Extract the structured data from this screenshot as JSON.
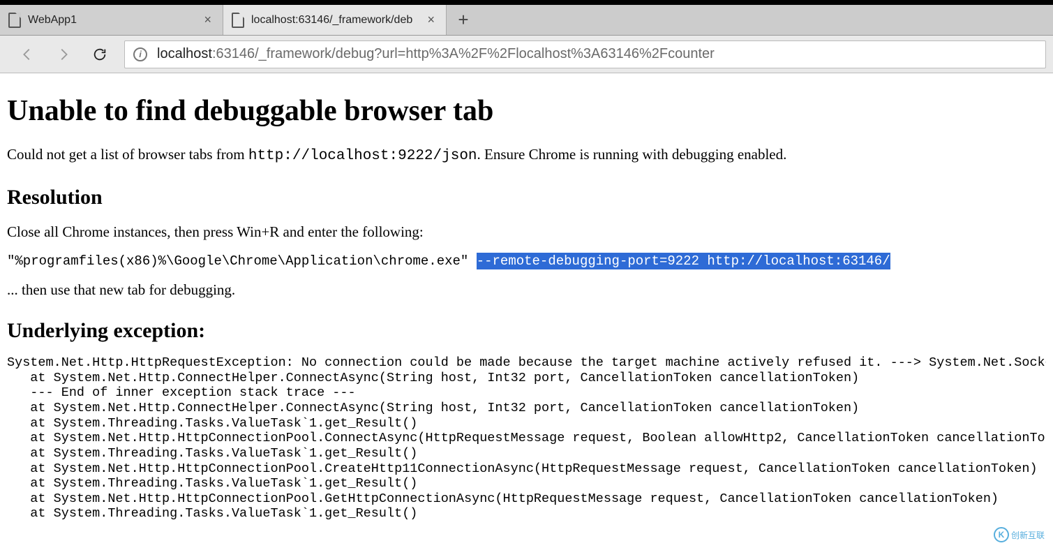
{
  "browser": {
    "tabs": [
      {
        "title": "WebApp1",
        "active": false
      },
      {
        "title": "localhost:63146/_framework/deb",
        "active": true
      }
    ],
    "new_tab_label": "+",
    "url_host": "localhost",
    "url_rest": ":63146/_framework/debug?url=http%3A%2F%2Flocalhost%3A63146%2Fcounter"
  },
  "page": {
    "heading": "Unable to find debuggable browser tab",
    "para1_prefix": "Could not get a list of browser tabs from ",
    "para1_code": "http://localhost:9222/json",
    "para1_suffix": ". Ensure Chrome is running with debugging enabled.",
    "resolution_heading": "Resolution",
    "resolution_intro": "Close all Chrome instances, then press Win+R and enter the following:",
    "cmd_unselected": "\"%programfiles(x86)%\\Google\\Chrome\\Application\\chrome.exe\" ",
    "cmd_selected": "--remote-debugging-port=9222 http://localhost:63146/",
    "resolution_outro": "... then use that new tab for debugging.",
    "exception_heading": "Underlying exception:",
    "stack_lines": [
      "System.Net.Http.HttpRequestException: No connection could be made because the target machine actively refused it. ---> System.Net.Sockets.SocketExcep",
      "   at System.Net.Http.ConnectHelper.ConnectAsync(String host, Int32 port, CancellationToken cancellationToken)",
      "   --- End of inner exception stack trace ---",
      "   at System.Net.Http.ConnectHelper.ConnectAsync(String host, Int32 port, CancellationToken cancellationToken)",
      "   at System.Threading.Tasks.ValueTask`1.get_Result()",
      "   at System.Net.Http.HttpConnectionPool.ConnectAsync(HttpRequestMessage request, Boolean allowHttp2, CancellationToken cancellationToken)",
      "   at System.Threading.Tasks.ValueTask`1.get_Result()",
      "   at System.Net.Http.HttpConnectionPool.CreateHttp11ConnectionAsync(HttpRequestMessage request, CancellationToken cancellationToken)",
      "   at System.Threading.Tasks.ValueTask`1.get_Result()",
      "   at System.Net.Http.HttpConnectionPool.GetHttpConnectionAsync(HttpRequestMessage request, CancellationToken cancellationToken)",
      "   at System.Threading.Tasks.ValueTask`1.get_Result()"
    ]
  },
  "watermark": {
    "symbol": "K",
    "text": "创新互联"
  }
}
